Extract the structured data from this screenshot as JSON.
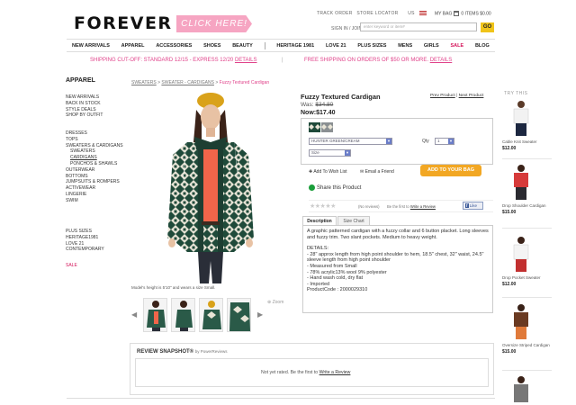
{
  "header": {
    "logo": "FOREVER 21",
    "click_here": "CLICK HERE!",
    "track_order": "TRACK ORDER",
    "store_locator": "STORE LOCATOR",
    "country": "US",
    "my_bag": "MY BAG",
    "bag_items": "0 ITEMS $0.00",
    "sign_in": "SIGN IN / JOIN",
    "search_placeholder": "enter keyword or item#",
    "go": "GO"
  },
  "nav": [
    "NEW ARRIVALS",
    "APPAREL",
    "ACCESSORIES",
    "SHOES",
    "BEAUTY",
    "HERITAGE 1981",
    "LOVE 21",
    "PLUS SIZES",
    "MENS",
    "GIRLS",
    "SALE",
    "BLOG"
  ],
  "shipping": {
    "left": "SHIPPING CUT-OFF: STANDARD 12/15 - EXPRESS 12/20",
    "left_link": "DETAILS",
    "sep": "|",
    "right": "FREE SHIPPING ON ORDERS OF $50 OR MORE.",
    "right_link": "DETAILS"
  },
  "sidebar": {
    "title": "APPAREL",
    "group1": [
      "NEW ARRIVALS",
      "BACK IN STOCK",
      "STYLE DEALS",
      "SHOP BY OUTFIT"
    ],
    "group2": [
      {
        "label": "DRESSES",
        "sub": false,
        "sel": false
      },
      {
        "label": "TOPS",
        "sub": false,
        "sel": false
      },
      {
        "label": "SWEATERS & CARDIGANS",
        "sub": false,
        "sel": false
      },
      {
        "label": "SWEATERS",
        "sub": true,
        "sel": false
      },
      {
        "label": "CARDIGANS",
        "sub": true,
        "sel": true
      },
      {
        "label": "PONCHOS & SHAWLS",
        "sub": true,
        "sel": false
      },
      {
        "label": "OUTERWEAR",
        "sub": false,
        "sel": false
      },
      {
        "label": "BOTTOMS",
        "sub": false,
        "sel": false
      },
      {
        "label": "JUMPSUITS & ROMPERS",
        "sub": false,
        "sel": false
      },
      {
        "label": "ACTIVEWEAR",
        "sub": false,
        "sel": false
      },
      {
        "label": "LINGERIE",
        "sub": false,
        "sel": false
      },
      {
        "label": "SWIM",
        "sub": false,
        "sel": false
      }
    ],
    "group3": [
      "PLUS SIZES",
      "HERITAGE1981",
      "LOVE 21 CONTEMPORARY"
    ],
    "sale": "SALE"
  },
  "breadcrumb": {
    "crumb1": "SWEATERS",
    "sep": " > ",
    "crumb2": "SWEATER - CARDIGANS",
    "current": "Fuzzy Textured Cardigan"
  },
  "model_caption": "Model's height is 5'10\" and wears a size Small.",
  "zoom": "Zoom",
  "product": {
    "name": "Fuzzy Textured Cardigan",
    "prev": "Prev Product",
    "next": "Next Product",
    "was_label": "Was:",
    "was_price": "$34.80",
    "now_label": "Now:",
    "now_price": "$17.40",
    "color": "HUNTER GREEN/CREAM",
    "qty_label": "Qty",
    "qty": "1",
    "size": "Size",
    "add_wishlist": "Add To Wish List",
    "email_friend": "Email a Friend",
    "add_to_bag": "ADD TO YOUR BAG",
    "share": "Share this Product",
    "stars": "★★★★★",
    "no_reviews": "(No reviews)",
    "be_first": "Be the first to",
    "write_review": "Write a Review",
    "like": "Like"
  },
  "tabs": {
    "description": "Description",
    "size_chart": "Size Chart"
  },
  "description": {
    "summary": "A graphic patterned cardigan with a fuzzy collar and 6 button placket. Long sleeves and fuzzy trim. Two slant pockets. Medium to heavy weight.",
    "details_title": "DETAILS:",
    "details": [
      "- 28\" approx length from high point shoulder to hem, 18.5\" chest, 32\" waist, 24.5\" sleeve length from high point shoulder",
      "- Measured from Small",
      "- 78% acrylic13% wool 9% polyester",
      "- Hand wash cold, dry flat",
      "- Imported",
      "ProductCode : 2000029310"
    ]
  },
  "review_snapshot": {
    "title": "REVIEW SNAPSHOT®",
    "by": "by PowerReviews",
    "text": "Not yet rated. Be the first to",
    "link": "Write a Review"
  },
  "try_this": {
    "title": "TRY THIS",
    "items": [
      {
        "name": "Cable Knit Sweater",
        "price": "$12.00",
        "top_color": "#f2f2f2",
        "bottom_color": "#1c2740"
      },
      {
        "name": "Drop Shoulder Cardigan",
        "price": "$15.00",
        "top_color": "#d63a3a",
        "bottom_color": "#2a2a30"
      },
      {
        "name": "Drop Pocket Sweater",
        "price": "$12.00",
        "top_color": "#f4f4f4",
        "bottom_color": "#c23030"
      },
      {
        "name": "Oversize Striped Cardigan",
        "price": "$15.00",
        "top_color": "#6a3a22",
        "bottom_color": "#e07a3a"
      }
    ]
  },
  "colors": {
    "accent_pink": "#e0428a",
    "sale_red": "#d4145a",
    "bag_button": "#f2a723",
    "go_button": "#f0c419"
  }
}
